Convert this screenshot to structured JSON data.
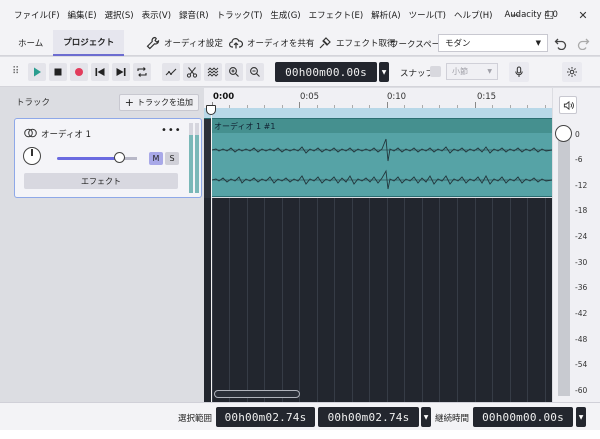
{
  "menu": {
    "items": [
      "ファイル(F)",
      "編集(E)",
      "選択(S)",
      "表示(V)",
      "録音(R)",
      "トラック(T)",
      "生成(G)",
      "エフェクト(E)",
      "解析(A)",
      "ツール(T)",
      "ヘルプ(H)"
    ],
    "app_title": "Audacity 4.0"
  },
  "window": {
    "minimize": "─",
    "maximize": "☐",
    "close": "✕"
  },
  "toolbar1": {
    "tab_home": "ホーム",
    "tab_project": "プロジェクト",
    "audio_settings": "オーディオ設定",
    "share_audio": "オーディオを共有",
    "get_effects": "エフェクト取得",
    "workspace_label": "ワークスペース",
    "workspace_value": "モダン"
  },
  "transport": {
    "timecode": "00h00m00.00s",
    "snap_label": "スナップ",
    "snap_value": "小節"
  },
  "tracks": {
    "header_label": "トラック",
    "add_track": "トラックを追加",
    "track_name": "オーディオ 1",
    "menu_dots": "•••",
    "mute": "M",
    "solo": "S",
    "effects": "エフェクト",
    "clip_title": "オーディオ 1 #1"
  },
  "ruler": {
    "labels": [
      "0:00",
      "0:05",
      "0:10",
      "0:15"
    ]
  },
  "meter": {
    "db_labels": [
      "0",
      "-6",
      "-12",
      "-18",
      "-24",
      "-30",
      "-36",
      "-42",
      "-48",
      "-54",
      "-60"
    ]
  },
  "bottom": {
    "selection_label": "選択範囲",
    "sel_start": "00h00m02.74s",
    "sel_end": "00h00m02.74s",
    "duration_label": "継続時間",
    "duration_value": "00h00m00.00s"
  },
  "colors": {
    "accent": "#6c6cd0",
    "waveform_bg": "#56a3a6",
    "dark_area": "#22262e",
    "record": "#e23c5c",
    "play": "#2a9d8f"
  }
}
